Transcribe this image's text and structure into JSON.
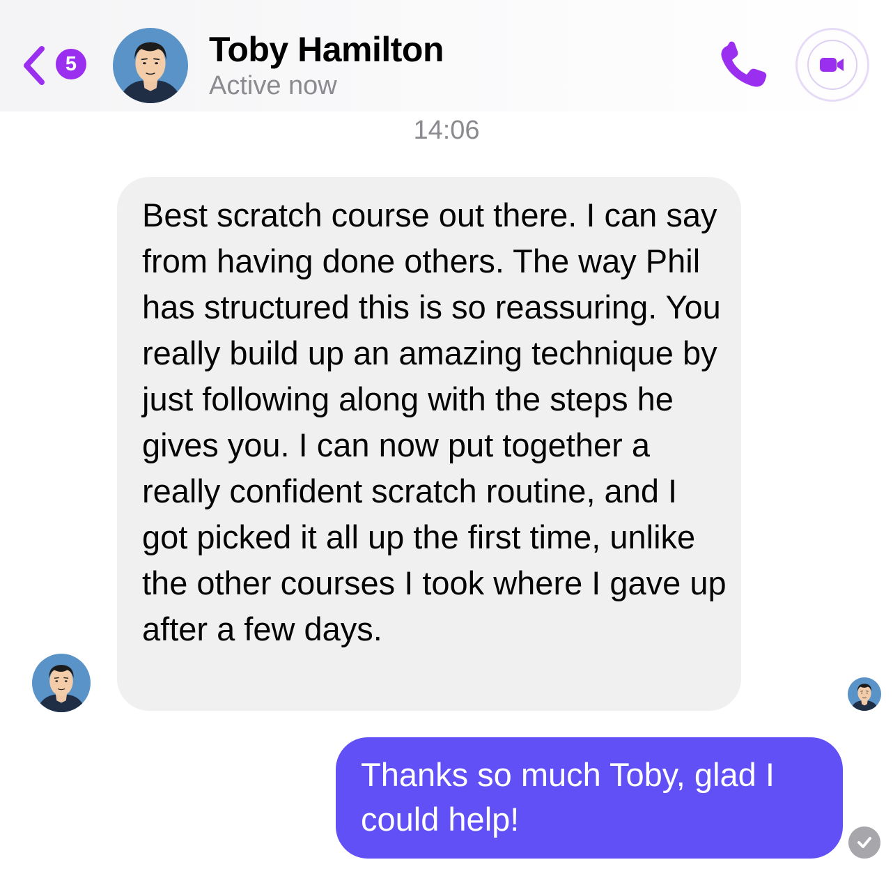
{
  "header": {
    "back_badge": "5",
    "contact_name": "Toby Hamilton",
    "status": "Active now"
  },
  "conversation": {
    "timestamp": "14:06",
    "incoming_message": "Best scratch course out there. I can say from having done others. The way Phil has structured this is so reassuring. You really build up an amazing technique by just following along with the steps he gives you. I can now put together a really confident scratch routine, and I got picked it all up the first time, unlike the other courses I took where I gave up after a few days.",
    "outgoing_message": "Thanks so much Toby, glad I could help!"
  },
  "colors": {
    "accent": "#9b2ff0",
    "outgoing_bubble": "#6050f6",
    "incoming_bubble": "#f0f0f0",
    "secondary_text": "#8a8a8f"
  },
  "icons": {
    "back": "chevron-left-icon",
    "call": "phone-icon",
    "video": "video-camera-icon",
    "read_receipt": "check-circle-icon"
  }
}
